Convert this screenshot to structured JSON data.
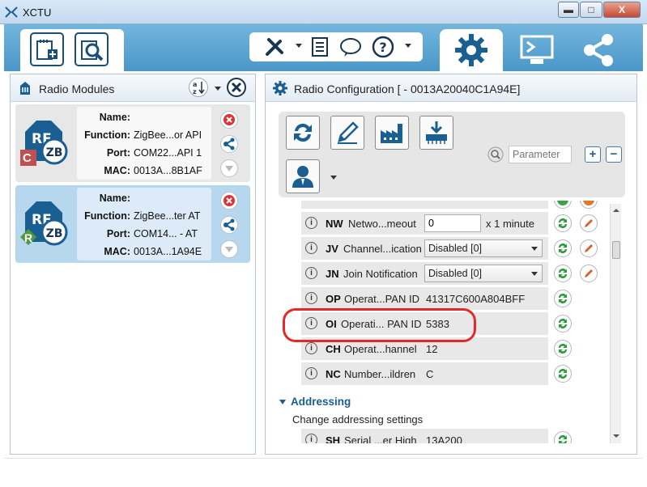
{
  "window": {
    "title": "XCTU",
    "minimize": "▬",
    "maximize": "□",
    "close": "X"
  },
  "toolbar": {
    "add_device_icon": "add-device-icon",
    "discover_icon": "discover-icon"
  },
  "perspectives": [
    "configuration",
    "console",
    "network"
  ],
  "left_panel": {
    "title": "Radio Modules",
    "modules": [
      {
        "badge": "C",
        "name_label": "Name:",
        "name": "",
        "function_label": "Function:",
        "function": "ZigBee...or API",
        "port_label": "Port:",
        "port": "COM22...API 1",
        "mac_label": "MAC:",
        "mac": "0013A...8B1AF"
      },
      {
        "badge": "R",
        "name_label": "Name:",
        "name": "",
        "function_label": "Function:",
        "function": "ZigBee...ter AT",
        "port_label": "Port:",
        "port": "COM14... - AT",
        "mac_label": "MAC:",
        "mac": "0013A...1A94E"
      }
    ]
  },
  "right_panel": {
    "title": "Radio Configuration [  - 0013A20040C1A94E]",
    "search_placeholder": "Parameter",
    "expand_label": "+",
    "collapse_label": "−",
    "params": [
      {
        "code": "NW",
        "name": "Netwo...meout",
        "kind": "input",
        "value": "0",
        "unit": "x 1 minute",
        "writable": true
      },
      {
        "code": "JV",
        "name": "Channel...ication",
        "kind": "select",
        "value": "Disabled [0]",
        "writable": true
      },
      {
        "code": "JN",
        "name": "Join Notification",
        "kind": "select",
        "value": "Disabled [0]",
        "writable": true
      },
      {
        "code": "OP",
        "name": "Operat...PAN ID",
        "kind": "text",
        "value": "41317C600A804BFF",
        "writable": false
      },
      {
        "code": "OI",
        "name": "Operati... PAN ID",
        "kind": "text",
        "value": "5383",
        "writable": false
      },
      {
        "code": "CH",
        "name": "Operat...hannel",
        "kind": "text",
        "value": "12",
        "writable": false
      },
      {
        "code": "NC",
        "name": "Number...ildren",
        "kind": "text",
        "value": "C",
        "writable": false
      }
    ],
    "section": {
      "title": "Addressing",
      "description": "Change addressing settings"
    },
    "partial_param": {
      "code": "SH",
      "name": "Serial ...er High",
      "value": "13A200"
    }
  },
  "colors": {
    "accent": "#1a5f91",
    "highlight": "#e32a2a",
    "card_selected": "#b6d7ee"
  }
}
